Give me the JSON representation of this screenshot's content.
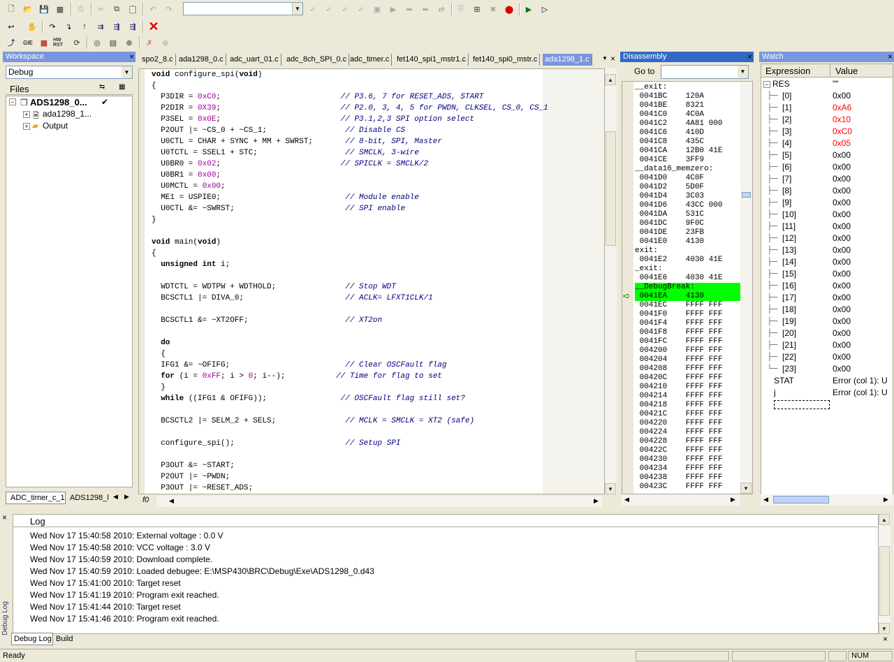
{
  "toolbar1": {
    "combo_value": ""
  },
  "workspace": {
    "title": "Workspace",
    "config": "Debug",
    "files_header": "Files",
    "project": "ADS1298_0...",
    "project_check": "✔",
    "file1": "ada1298_1...",
    "folder": "Output",
    "tab1": "ADC_timer_c_1",
    "tab2": "ADS1298_l"
  },
  "editor": {
    "tabs": [
      "spo2_8.c",
      "ada1298_0.c",
      "adc_uart_01.c",
      "adc_8ch_SPI_0.c",
      "adc_timer.c",
      "fet140_spi1_mstr1.c",
      "fet140_spi0_mstr.c",
      "ada1298_1.c"
    ],
    "bottom_label": "f0"
  },
  "disasm": {
    "title": "Disassembly",
    "goto_label": "Go to",
    "lines": [
      "__exit:",
      " 0041BC    120A",
      " 0041BE    8321",
      " 0041C0    4C0A",
      " 0041C2    4A81 000",
      " 0041C6    410D",
      " 0041C8    435C",
      " 0041CA    12B0 41E",
      " 0041CE    3FF9",
      "__data16_memzero:",
      " 0041D0    4C0F",
      " 0041D2    5D0F",
      " 0041D4    3C03",
      " 0041D6    43CC 000",
      " 0041DA    531C",
      " 0041DC    9F0C",
      " 0041DE    23FB",
      " 0041E0    4130",
      "exit:",
      " 0041E2    4030 41E",
      "_exit:",
      " 0041E6    4030 41E",
      "__DebugBreak:",
      " 0041EA    4130",
      " 0041EC    FFFF FFF",
      " 0041F0    FFFF FFF",
      " 0041F4    FFFF FFF",
      " 0041F8    FFFF FFF",
      " 0041FC    FFFF FFF",
      " 004200    FFFF FFF",
      " 004204    FFFF FFF",
      " 004208    FFFF FFF",
      " 00420C    FFFF FFF",
      " 004210    FFFF FFF",
      " 004214    FFFF FFF",
      " 004218    FFFF FFF",
      " 00421C    FFFF FFF",
      " 004220    FFFF FFF",
      " 004224    FFFF FFF",
      " 004228    FFFF FFF",
      " 00422C    FFFF FFF",
      " 004230    FFFF FFF",
      " 004234    FFFF FFF",
      " 004238    FFFF FFF",
      " 00423C    FFFF FFF"
    ],
    "highlight_color": "#00ff00"
  },
  "watch": {
    "title": "Watch",
    "col_expression": "Expression",
    "col_value": "Value",
    "res_name": "RES",
    "res_value": "\"\"",
    "items": [
      {
        "name": "[0]",
        "value": "0x00",
        "changed": false
      },
      {
        "name": "[1]",
        "value": "0xA6",
        "changed": true
      },
      {
        "name": "[2]",
        "value": "0x10",
        "changed": true
      },
      {
        "name": "[3]",
        "value": "0xC0",
        "changed": true
      },
      {
        "name": "[4]",
        "value": "0x05",
        "changed": true
      },
      {
        "name": "[5]",
        "value": "0x00",
        "changed": false
      },
      {
        "name": "[6]",
        "value": "0x00",
        "changed": false
      },
      {
        "name": "[7]",
        "value": "0x00",
        "changed": false
      },
      {
        "name": "[8]",
        "value": "0x00",
        "changed": false
      },
      {
        "name": "[9]",
        "value": "0x00",
        "changed": false
      },
      {
        "name": "[10]",
        "value": "0x00",
        "changed": false
      },
      {
        "name": "[11]",
        "value": "0x00",
        "changed": false
      },
      {
        "name": "[12]",
        "value": "0x00",
        "changed": false
      },
      {
        "name": "[13]",
        "value": "0x00",
        "changed": false
      },
      {
        "name": "[14]",
        "value": "0x00",
        "changed": false
      },
      {
        "name": "[15]",
        "value": "0x00",
        "changed": false
      },
      {
        "name": "[16]",
        "value": "0x00",
        "changed": false
      },
      {
        "name": "[17]",
        "value": "0x00",
        "changed": false
      },
      {
        "name": "[18]",
        "value": "0x00",
        "changed": false
      },
      {
        "name": "[19]",
        "value": "0x00",
        "changed": false
      },
      {
        "name": "[20]",
        "value": "0x00",
        "changed": false
      },
      {
        "name": "[21]",
        "value": "0x00",
        "changed": false
      },
      {
        "name": "[22]",
        "value": "0x00",
        "changed": false
      },
      {
        "name": "[23]",
        "value": "0x00",
        "changed": false
      }
    ],
    "stat_name": "STAT",
    "stat_value": "Error (col 1): U",
    "j_name": "j",
    "j_value": "Error (col 1): U",
    "changed_color": "#ff0000"
  },
  "log": {
    "header": "Log",
    "side_label": "Debug Log",
    "lines": [
      "Wed Nov 17 15:40:58 2010: External voltage : 0.0 V",
      "Wed Nov 17 15:40:58 2010: VCC voltage : 3.0 V",
      "Wed Nov 17 15:40:59 2010: Download complete.",
      "Wed Nov 17 15:40:59 2010: Loaded debugee: E:\\MSP430\\BRC\\Debug\\Exe\\ADS1298_0.d43",
      "Wed Nov 17 15:41:00 2010: Target reset",
      "Wed Nov 17 15:41:19 2010: Program exit reached.",
      "Wed Nov 17 15:41:44 2010: Target reset",
      "Wed Nov 17 15:41:46 2010: Program exit reached."
    ],
    "tab1": "Debug Log",
    "tab2": "Build"
  },
  "status": {
    "text": "Ready",
    "num": "NUM"
  }
}
